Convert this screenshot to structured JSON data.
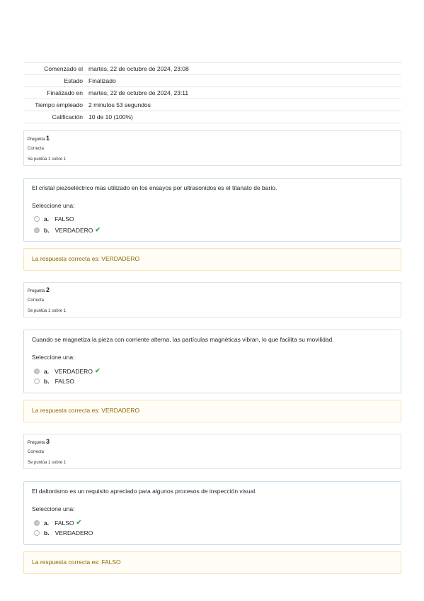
{
  "summary": {
    "rows": [
      {
        "label": "Comenzado el",
        "value": "martes, 22 de octubre de 2024, 23:08"
      },
      {
        "label": "Estado",
        "value": "Finalizado"
      },
      {
        "label": "Finalizado en",
        "value": "martes, 22 de octubre de 2024, 23:11"
      },
      {
        "label": "Tiempo empleado",
        "value": "2 minutos 53 segundos"
      },
      {
        "label": "Calificación",
        "value": "10 de 10 (100%)"
      }
    ]
  },
  "questions": [
    {
      "prefix": "Pregunta",
      "number": "1",
      "state": "Correcta",
      "grade": "Se puntúa 1 sobre 1",
      "text": "El cristal piezoeléctrico mas utilizado en los ensayos por ultrasonidos es el titanato de bario.",
      "prompt": "Seleccione una:",
      "options": [
        {
          "letter": "a.",
          "label": "FALSO",
          "selected": false,
          "correct": false
        },
        {
          "letter": "b.",
          "label": "VERDADERO",
          "selected": true,
          "correct": true
        }
      ],
      "feedback": "La respuesta correcta es: VERDADERO"
    },
    {
      "prefix": "Pregunta",
      "number": "2",
      "state": "Correcta",
      "grade": "Se puntúa 1 sobre 1",
      "text": "Cuando se magnetiza la pieza con corriente alterna, las partículas magnéticas vibran, lo que facilita su movilidad.",
      "prompt": "Seleccione una:",
      "options": [
        {
          "letter": "a.",
          "label": "VERDADERO",
          "selected": true,
          "correct": true
        },
        {
          "letter": "b.",
          "label": "FALSO",
          "selected": false,
          "correct": false
        }
      ],
      "feedback": "La respuesta correcta es: VERDADERO"
    },
    {
      "prefix": "Pregunta",
      "number": "3",
      "state": "Correcta",
      "grade": "Se puntúa 1 sobre 1",
      "text": "El daltonismo es un requisito apreciado para algunos procesos de inspección visual.",
      "prompt": "Seleccione una:",
      "options": [
        {
          "letter": "a.",
          "label": "FALSO",
          "selected": true,
          "correct": true
        },
        {
          "letter": "b.",
          "label": "VERDADERO",
          "selected": false,
          "correct": false
        }
      ],
      "feedback": "La respuesta correcta es: FALSO"
    }
  ],
  "icons": {
    "correct": "check-icon",
    "radio": "radio-icon"
  },
  "colors": {
    "correct": "#39a04a",
    "feedback_text": "#8e6a00",
    "feedback_border": "#f7e2b4",
    "formulation_border": "#c9dfe7"
  }
}
